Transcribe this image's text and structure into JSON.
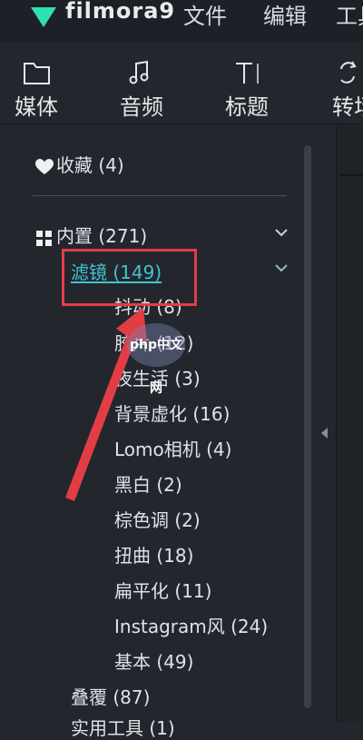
{
  "topbar": {
    "app_name": "filmora9",
    "menus": [
      "文件",
      "编辑",
      "工具"
    ]
  },
  "toolbar": {
    "tools": [
      {
        "label": "媒体",
        "icon": "folder-icon"
      },
      {
        "label": "音频",
        "icon": "music-note-icon"
      },
      {
        "label": "标题",
        "icon": "title-text-icon"
      },
      {
        "label": "转场",
        "icon": "transition-icon"
      }
    ]
  },
  "tree": {
    "favorites": "收藏 (4)",
    "builtin": "内置 (271)",
    "filters": "滤镜 (149)",
    "filter_items": [
      "抖动 (8)",
      "胶片 (12)",
      "夜生活 (3)",
      "背景虚化 (16)",
      "Lomo相机 (4)",
      "黑白 (2)",
      "棕色调 (2)",
      "扭曲 (18)",
      "扁平化 (11)",
      "Instagram风 (24)",
      "基本 (49)"
    ],
    "overlay": "叠覆 (87)",
    "cut_off": "实用工具 (1)"
  },
  "watermark": {
    "text": "php中文网"
  },
  "colors": {
    "background": "#23262d",
    "accent_active": "#3fc6d0",
    "annotation_red": "#e23d45",
    "logo": "#2fe0b4"
  }
}
